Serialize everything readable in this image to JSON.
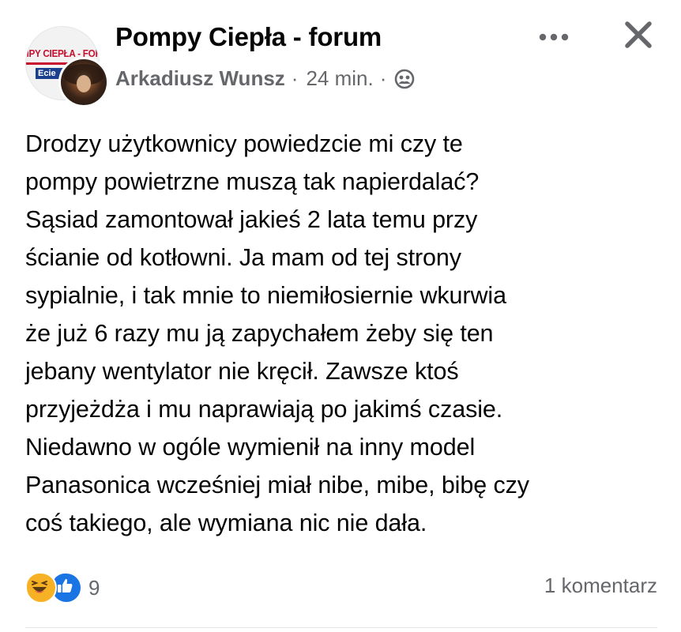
{
  "header": {
    "group_name": "Pompy Ciepła - forum",
    "group_avatar_text": "MPY CIEPŁA - FOR",
    "group_avatar_tag": "Ecie",
    "author": "Arkadiusz Wunsz",
    "separator": "·",
    "time": "24 min.",
    "privacy_icon": "group-members-icon"
  },
  "post": {
    "lines": [
      "Drodzy użytkownicy powiedzcie mi czy te",
      "pompy powietrzne muszą tak napierdalać?",
      "Sąsiad zamontował jakieś 2 lata temu przy",
      "ścianie od kotłowni. Ja mam od tej strony",
      "sypialnie, i tak mnie to niemiłosiernie wkurwia",
      "że już 6 razy mu ją zapychałem żeby się ten",
      "jebany wentylator nie kręcił. Zawsze ktoś",
      "przyjeżdża i mu naprawiają po jakimś czasie.",
      "Niedawno w ogóle wymienił na inny model",
      "Panasonica wcześniej miał nibe, mibe, bibę czy",
      "coś takiego, ale wymiana nic nie dała."
    ]
  },
  "footer": {
    "reaction_icons": [
      "haha-icon",
      "like-icon"
    ],
    "reaction_count": "9",
    "comments": "1 komentarz"
  },
  "colors": {
    "text": "#050505",
    "secondary": "#65676b",
    "like_blue": "#1b74e4",
    "haha_yellow": "#f7b125"
  }
}
